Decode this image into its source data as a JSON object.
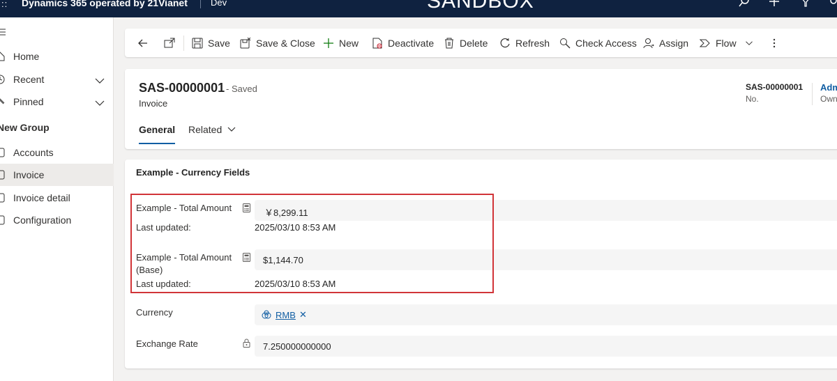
{
  "topbar": {
    "app_title": "Dynamics 365 operated by 21Vianet",
    "environment": "Dev",
    "sandbox_label": "SANDBOX"
  },
  "sidebar": {
    "items": [
      {
        "label": "Home"
      },
      {
        "label": "Recent"
      },
      {
        "label": "Pinned"
      }
    ],
    "group_title": "New Group",
    "group_items": [
      {
        "label": "Accounts"
      },
      {
        "label": "Invoice"
      },
      {
        "label": "Invoice detail"
      },
      {
        "label": "Configuration"
      }
    ]
  },
  "commandbar": {
    "save": "Save",
    "save_close": "Save & Close",
    "new": "New",
    "deactivate": "Deactivate",
    "delete": "Delete",
    "refresh": "Refresh",
    "check_access": "Check Access",
    "assign": "Assign",
    "flow": "Flow"
  },
  "header": {
    "record_title": "SAS-00000001",
    "saved_status": "- Saved",
    "entity": "Invoice",
    "tabs": [
      "General",
      "Related"
    ],
    "no_value": "SAS-00000001",
    "no_label": "No.",
    "owner_value": "Adm",
    "owner_label": "Owne"
  },
  "section": {
    "title": "Example - Currency Fields",
    "fields": {
      "total_amount_label": "Example - Total Amount",
      "total_amount_value": "￥8,299.11",
      "total_amount_updated_label": "Last updated:",
      "total_amount_updated_value": "2025/03/10 8:53 AM",
      "total_amount_base_label_1": "Example - Total Amount",
      "total_amount_base_label_2": "(Base)",
      "total_amount_base_value": "$1,144.70",
      "total_amount_base_updated_label": "Last updated:",
      "total_amount_base_updated_value": "2025/03/10 8:53 AM",
      "currency_label": "Currency",
      "currency_value": "RMB",
      "exchange_rate_label": "Exchange Rate",
      "exchange_rate_value": "7.250000000000"
    }
  },
  "colors": {
    "topbar": "#0f2240",
    "accent": "#115ea3",
    "highlight": "#d13438"
  }
}
